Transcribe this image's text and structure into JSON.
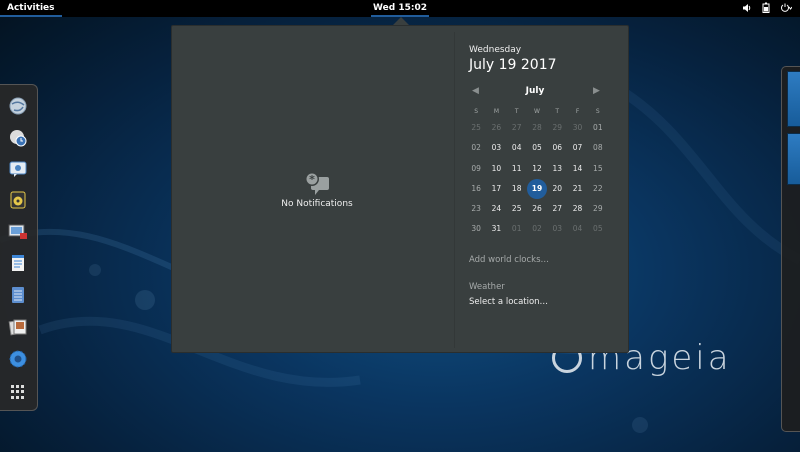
{
  "topbar": {
    "activities_label": "Activities",
    "clock_label": "Wed 15:02",
    "tray_icons": [
      "audio-volume-icon",
      "power-icon"
    ]
  },
  "dash": {
    "apps": [
      {
        "name": "web-browser-icon",
        "color": "#cfd8e2"
      },
      {
        "name": "clock-icon",
        "color": "#d9d9d9"
      },
      {
        "name": "messaging-icon",
        "color": "#6aa3d9"
      },
      {
        "name": "audio-player-icon",
        "color": "#e6c84a"
      },
      {
        "name": "screenshot-icon",
        "color": "#7aa7d7"
      },
      {
        "name": "text-document-icon",
        "color": "#4a8fd8"
      },
      {
        "name": "spreadsheet-icon",
        "color": "#5d8ecf"
      },
      {
        "name": "image-viewer-icon",
        "color": "#d8d8d8"
      },
      {
        "name": "settings-icon",
        "color": "#3d8fe0"
      }
    ]
  },
  "wallpaper": {
    "brand": "mageia"
  },
  "notifications": {
    "empty_text": "No Notifications"
  },
  "calendar": {
    "weekday": "Wednesday",
    "full_date": "July 19 2017",
    "month_label": "July",
    "prev_arrow": "◀",
    "next_arrow": "▶",
    "day_headers": [
      "S",
      "M",
      "T",
      "W",
      "T",
      "F",
      "S"
    ],
    "weeks": [
      [
        {
          "d": "25",
          "o": true
        },
        {
          "d": "26",
          "o": true
        },
        {
          "d": "27",
          "o": true
        },
        {
          "d": "28",
          "o": true
        },
        {
          "d": "29",
          "o": true
        },
        {
          "d": "30",
          "o": true
        },
        {
          "d": "01",
          "w": true
        }
      ],
      [
        {
          "d": "02",
          "w": true
        },
        {
          "d": "03"
        },
        {
          "d": "04"
        },
        {
          "d": "05"
        },
        {
          "d": "06"
        },
        {
          "d": "07"
        },
        {
          "d": "08",
          "w": true
        }
      ],
      [
        {
          "d": "09",
          "w": true
        },
        {
          "d": "10"
        },
        {
          "d": "11"
        },
        {
          "d": "12"
        },
        {
          "d": "13"
        },
        {
          "d": "14"
        },
        {
          "d": "15",
          "w": true
        }
      ],
      [
        {
          "d": "16",
          "w": true
        },
        {
          "d": "17"
        },
        {
          "d": "18"
        },
        {
          "d": "19",
          "t": true
        },
        {
          "d": "20"
        },
        {
          "d": "21"
        },
        {
          "d": "22",
          "w": true
        }
      ],
      [
        {
          "d": "23",
          "w": true
        },
        {
          "d": "24"
        },
        {
          "d": "25"
        },
        {
          "d": "26"
        },
        {
          "d": "27"
        },
        {
          "d": "28"
        },
        {
          "d": "29",
          "w": true
        }
      ],
      [
        {
          "d": "30",
          "w": true
        },
        {
          "d": "31"
        },
        {
          "d": "01",
          "o": true
        },
        {
          "d": "02",
          "o": true
        },
        {
          "d": "03",
          "o": true
        },
        {
          "d": "04",
          "o": true
        },
        {
          "d": "05",
          "o": true
        }
      ]
    ],
    "world_clocks_link": "Add world clocks…",
    "weather_title": "Weather",
    "weather_location": "Select a location…"
  },
  "colors": {
    "accent": "#215d9c",
    "popup_bg": "#393f3f"
  }
}
